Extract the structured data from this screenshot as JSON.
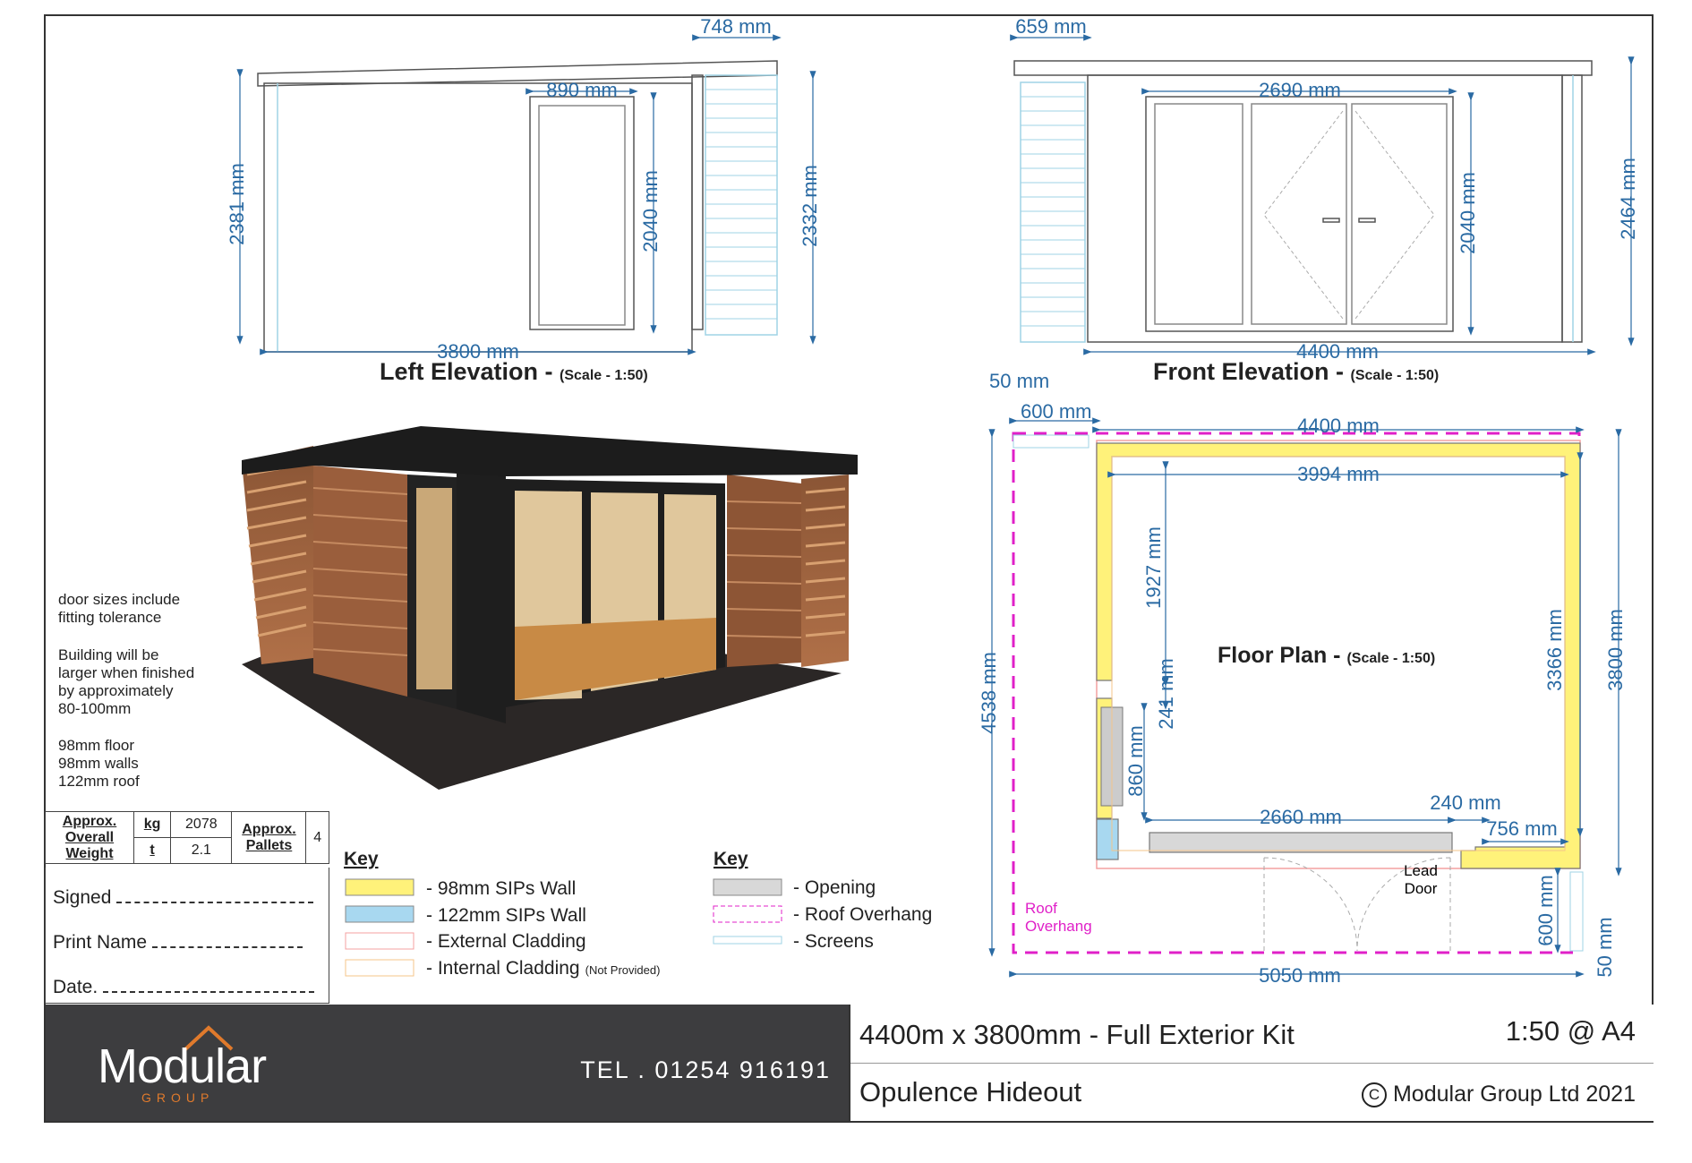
{
  "left_elevation": {
    "title": "Left Elevation - ",
    "scale": "(Scale - 1:50)",
    "dims": {
      "top_width": "748 mm",
      "door_width": "890 mm",
      "left_height": "2381 mm",
      "door_height": "2040 mm",
      "right_height": "2332 mm",
      "bottom_width": "3800 mm"
    }
  },
  "front_elevation": {
    "title": "Front Elevation - ",
    "scale": "(Scale - 1:50)",
    "dims": {
      "top_width": "659 mm",
      "door_width": "2690 mm",
      "door_height": "2040 mm",
      "height": "2464 mm",
      "bottom_width": "4400 mm"
    }
  },
  "floor_plan": {
    "title": "Floor Plan - ",
    "scale": "(Scale - 1:50)",
    "dims": {
      "d50_top": "50 mm",
      "d600_top": "600 mm",
      "d4400": "4400 mm",
      "d3994": "3994 mm",
      "d1927": "1927 mm",
      "d241": "241 mm",
      "d860": "860 mm",
      "d3366": "3366 mm",
      "d3800": "3800 mm",
      "d4538": "4538 mm",
      "d2660": "2660 mm",
      "d240": "240 mm",
      "d756": "756 mm",
      "d600_bottom": "600 mm",
      "d50_bottom": "50 mm",
      "d5050": "5050 mm"
    },
    "roof_overhang_label": [
      "Roof",
      "Overhang"
    ],
    "lead_door_label": [
      "Lead",
      "Door"
    ]
  },
  "notes": [
    "door sizes include",
    "fitting tolerance",
    "",
    "Building will be",
    "larger when finished",
    "by approximately",
    "80-100mm",
    "",
    "98mm floor",
    "98mm walls",
    "122mm roof"
  ],
  "weight_table": {
    "label": [
      "Approx.",
      "Overall",
      "Weight"
    ],
    "unit_kg": "kg",
    "kg": "2078",
    "unit_t": "t",
    "t": "2.1",
    "pallets_label": [
      "Approx.",
      "Pallets"
    ],
    "pallets": "4"
  },
  "sign_off": {
    "signed": "Signed",
    "print_name": "Print Name",
    "date": "Date."
  },
  "key1": {
    "title": "Key",
    "items": [
      {
        "label": "- 98mm SIPs Wall",
        "color": "#fff27a"
      },
      {
        "label": "- 122mm SIPs Wall",
        "color": "#a8d8f0"
      },
      {
        "label": "- External Cladding",
        "color": "#f4a0a0"
      },
      {
        "label": "- Internal Cladding",
        "note": "(Not Provided)",
        "color": "#f5c48a"
      }
    ]
  },
  "key2": {
    "title": "Key",
    "items": [
      {
        "label": "- Opening",
        "color": "#d8d8d8"
      },
      {
        "label": "- Roof Overhang",
        "color": "#e020c8"
      },
      {
        "label": "- Screens",
        "color": "#8fd0e0"
      }
    ]
  },
  "footer": {
    "logo": "Modular",
    "logo_sub": "GROUP",
    "tel": "TEL . 01254 916191",
    "kit": "4400m x 3800mm - Full Exterior Kit",
    "scale": "1:50 @ A4",
    "product": "Opulence Hideout",
    "copyright": "Modular Group Ltd 2021",
    "copyright_symbol": "C"
  },
  "colors": {
    "dimension": "#2a6aa3",
    "footer_bg": "#3d3d3f",
    "accent": "#e07a2c",
    "sips_wall": "#fff27a",
    "overhang": "#e020c8"
  }
}
